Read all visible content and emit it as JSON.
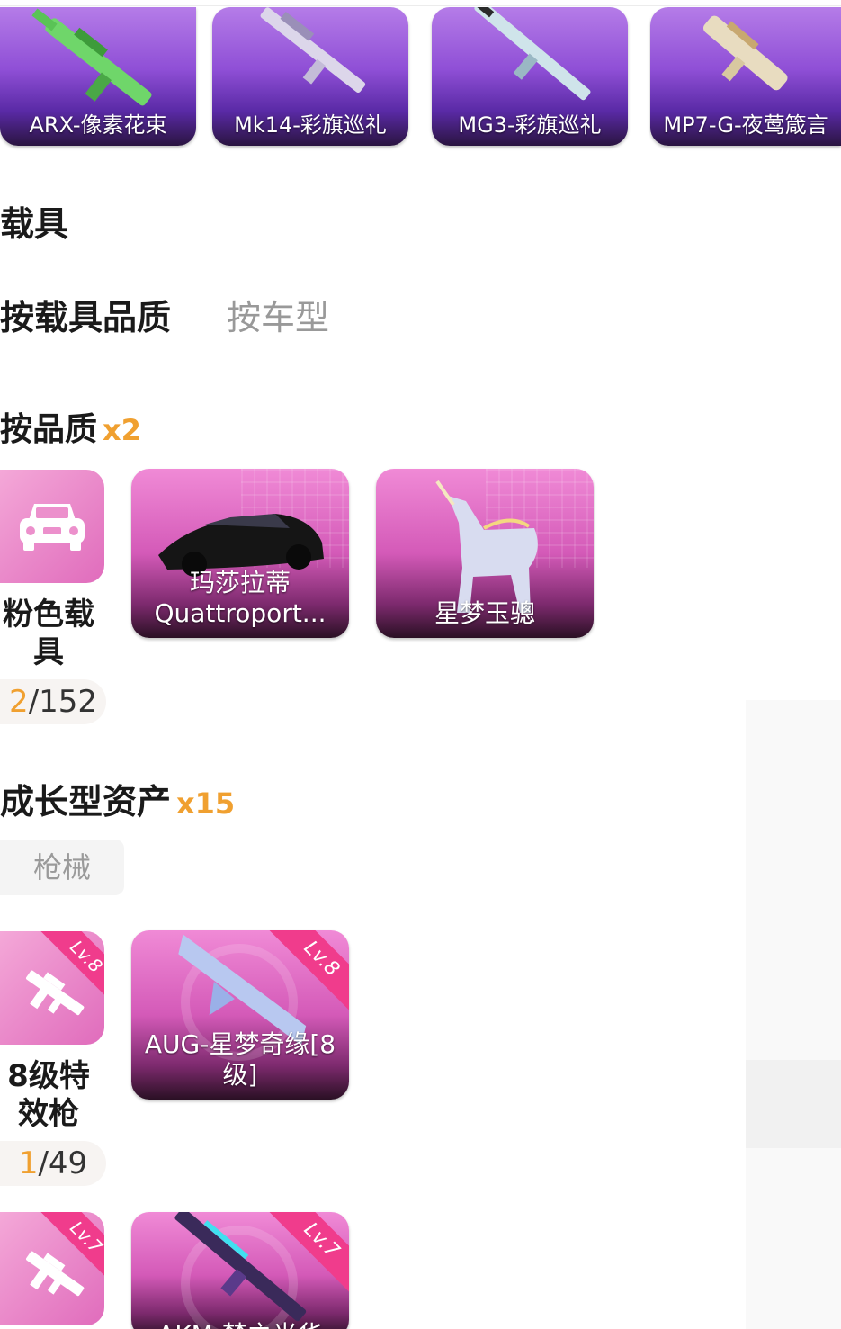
{
  "weapons_row": [
    {
      "name": "ARX-像素花束",
      "icon": "green-rifle-icon"
    },
    {
      "name": "Mk14-彩旗巡礼",
      "icon": "rifle-icon"
    },
    {
      "name": "MG3-彩旗巡礼",
      "icon": "machine-gun-icon"
    },
    {
      "name": "MP7-G-夜莺箴言",
      "icon": "smg-icon"
    }
  ],
  "vehicles_section": {
    "title": "载具",
    "tabs": [
      {
        "label": "按载具品质",
        "active": true
      },
      {
        "label": "按车型",
        "active": false
      }
    ],
    "quality_group": {
      "title": "按品质",
      "count": "x2",
      "category": {
        "name": "粉色载具",
        "have": "2",
        "total": "/152",
        "icon": "car-icon"
      },
      "items": [
        {
          "name": "玛莎拉蒂Quattroport...",
          "icon": "sports-car-icon"
        },
        {
          "name": "星梦玉骢",
          "icon": "unicorn-icon"
        }
      ]
    }
  },
  "growth_section": {
    "title": "成长型资产",
    "count": "x15",
    "filter": "枪械",
    "groups": [
      {
        "category": {
          "name": "8级特效枪",
          "have": "1",
          "total": "/49",
          "level": "Lv.8",
          "icon": "rifle-icon"
        },
        "items": [
          {
            "name": "AUG-星梦奇缘[8级]",
            "level": "Lv.8",
            "icon": "crystal-rifle-icon"
          }
        ]
      },
      {
        "category": {
          "level": "Lv.7",
          "icon": "rifle-icon"
        },
        "items": [
          {
            "name": "AKM-梦之光华",
            "level": "Lv.7",
            "icon": "neon-rifle-icon"
          }
        ]
      }
    ]
  },
  "colors": {
    "accent": "#f0a030",
    "pink": "#e06cbc",
    "purple": "#8f4fd6",
    "ribbon": "#f03c8c"
  }
}
